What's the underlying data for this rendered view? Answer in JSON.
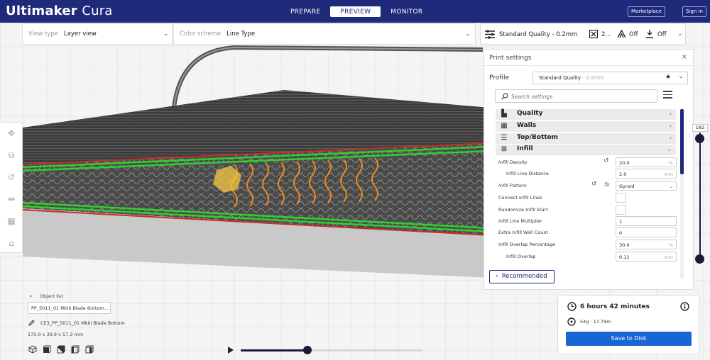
{
  "app": {
    "brand_bold": "Ultimaker",
    "brand_light": "Cura"
  },
  "stages": [
    "PREPARE",
    "PREVIEW",
    "MONITOR"
  ],
  "header_buttons": {
    "marketplace": "Marketplace",
    "signin": "Sign in"
  },
  "view_type": {
    "label": "View type",
    "value": "Layer view"
  },
  "color_scheme": {
    "label": "Color scheme",
    "value": "Line Type"
  },
  "quality_bar": {
    "profile": "Standard Quality - 0.2mm",
    "infill": "2...",
    "support": "Off",
    "adhesion": "Off"
  },
  "print_settings": {
    "title": "Print settings",
    "profile_label": "Profile",
    "profile_value": "Standard Quality",
    "profile_suffix": " - 0.2mm",
    "search_placeholder": "Search settings",
    "categories": [
      "Quality",
      "Walls",
      "Top/Bottom",
      "Infill"
    ],
    "settings": [
      {
        "label": "Infill Density",
        "value": "20.0",
        "unit": "%"
      },
      {
        "label": "Infill Line Distance",
        "value": "2.0",
        "unit": "mm"
      },
      {
        "label": "Infill Pattern",
        "value": "Gyroid",
        "unit": ""
      },
      {
        "label": "Connect Infill Lines"
      },
      {
        "label": "Randomize Infill Start"
      },
      {
        "label": "Infill Line Multiplier",
        "value": "1",
        "unit": ""
      },
      {
        "label": "Extra Infill Wall Count",
        "value": "0",
        "unit": ""
      },
      {
        "label": "Infill Overlap Percentage",
        "value": "30.0",
        "unit": "%"
      },
      {
        "label": "Infill Overlap",
        "value": "0.12",
        "unit": "mm"
      }
    ],
    "recommended": "Recommended"
  },
  "action_panel": {
    "time": "6 hours 42 minutes",
    "material": "54g · 17.79m",
    "save": "Save to Disk"
  },
  "layer": {
    "current": "182"
  },
  "object_list": {
    "label": "Object list",
    "item": "PP_5011_01 MkIII Blade Bottom....",
    "name": "CE3_PP_5011_01 MkIII Blade Bottom",
    "dims": "175.0 x 39.9 x 57.3 mm"
  },
  "icons": [
    "move-icon",
    "scale-icon",
    "rotate-icon",
    "mirror-icon",
    "per-model-settings-icon",
    "support-blocker-icon",
    "search-icon",
    "star-icon",
    "clock-icon",
    "info-icon",
    "spool-icon",
    "play-icon"
  ]
}
